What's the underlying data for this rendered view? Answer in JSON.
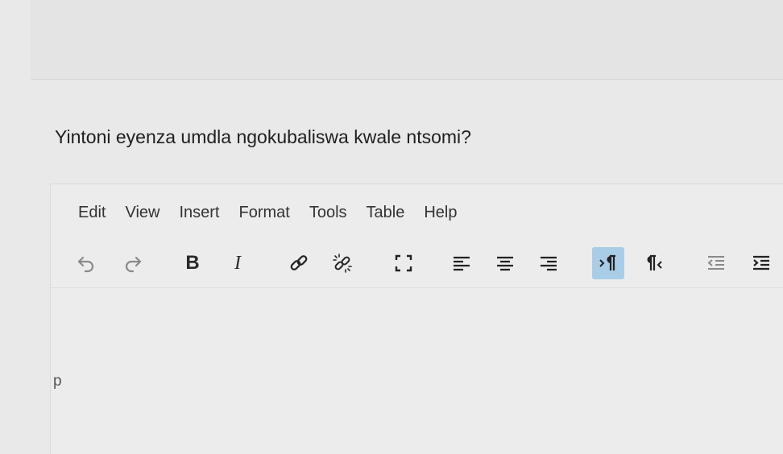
{
  "question": "Yintoni eyenza umdla ngokubaliswa kwale ntsomi?",
  "menubar": {
    "items": [
      "Edit",
      "View",
      "Insert",
      "Format",
      "Tools",
      "Table",
      "Help"
    ]
  },
  "toolbar": {
    "buttons": [
      {
        "name": "undo-icon"
      },
      {
        "name": "redo-icon"
      },
      {
        "name": "bold-button",
        "label": "B"
      },
      {
        "name": "italic-button",
        "label": "I"
      },
      {
        "name": "link-icon"
      },
      {
        "name": "unlink-icon"
      },
      {
        "name": "fullscreen-icon"
      },
      {
        "name": "align-left-icon"
      },
      {
        "name": "align-center-icon"
      },
      {
        "name": "align-right-icon"
      },
      {
        "name": "ltr-icon",
        "active": true
      },
      {
        "name": "rtl-icon"
      },
      {
        "name": "outdent-icon"
      },
      {
        "name": "indent-icon"
      }
    ],
    "accent": "#a9cde6"
  },
  "statusbar": {
    "path": "p"
  }
}
